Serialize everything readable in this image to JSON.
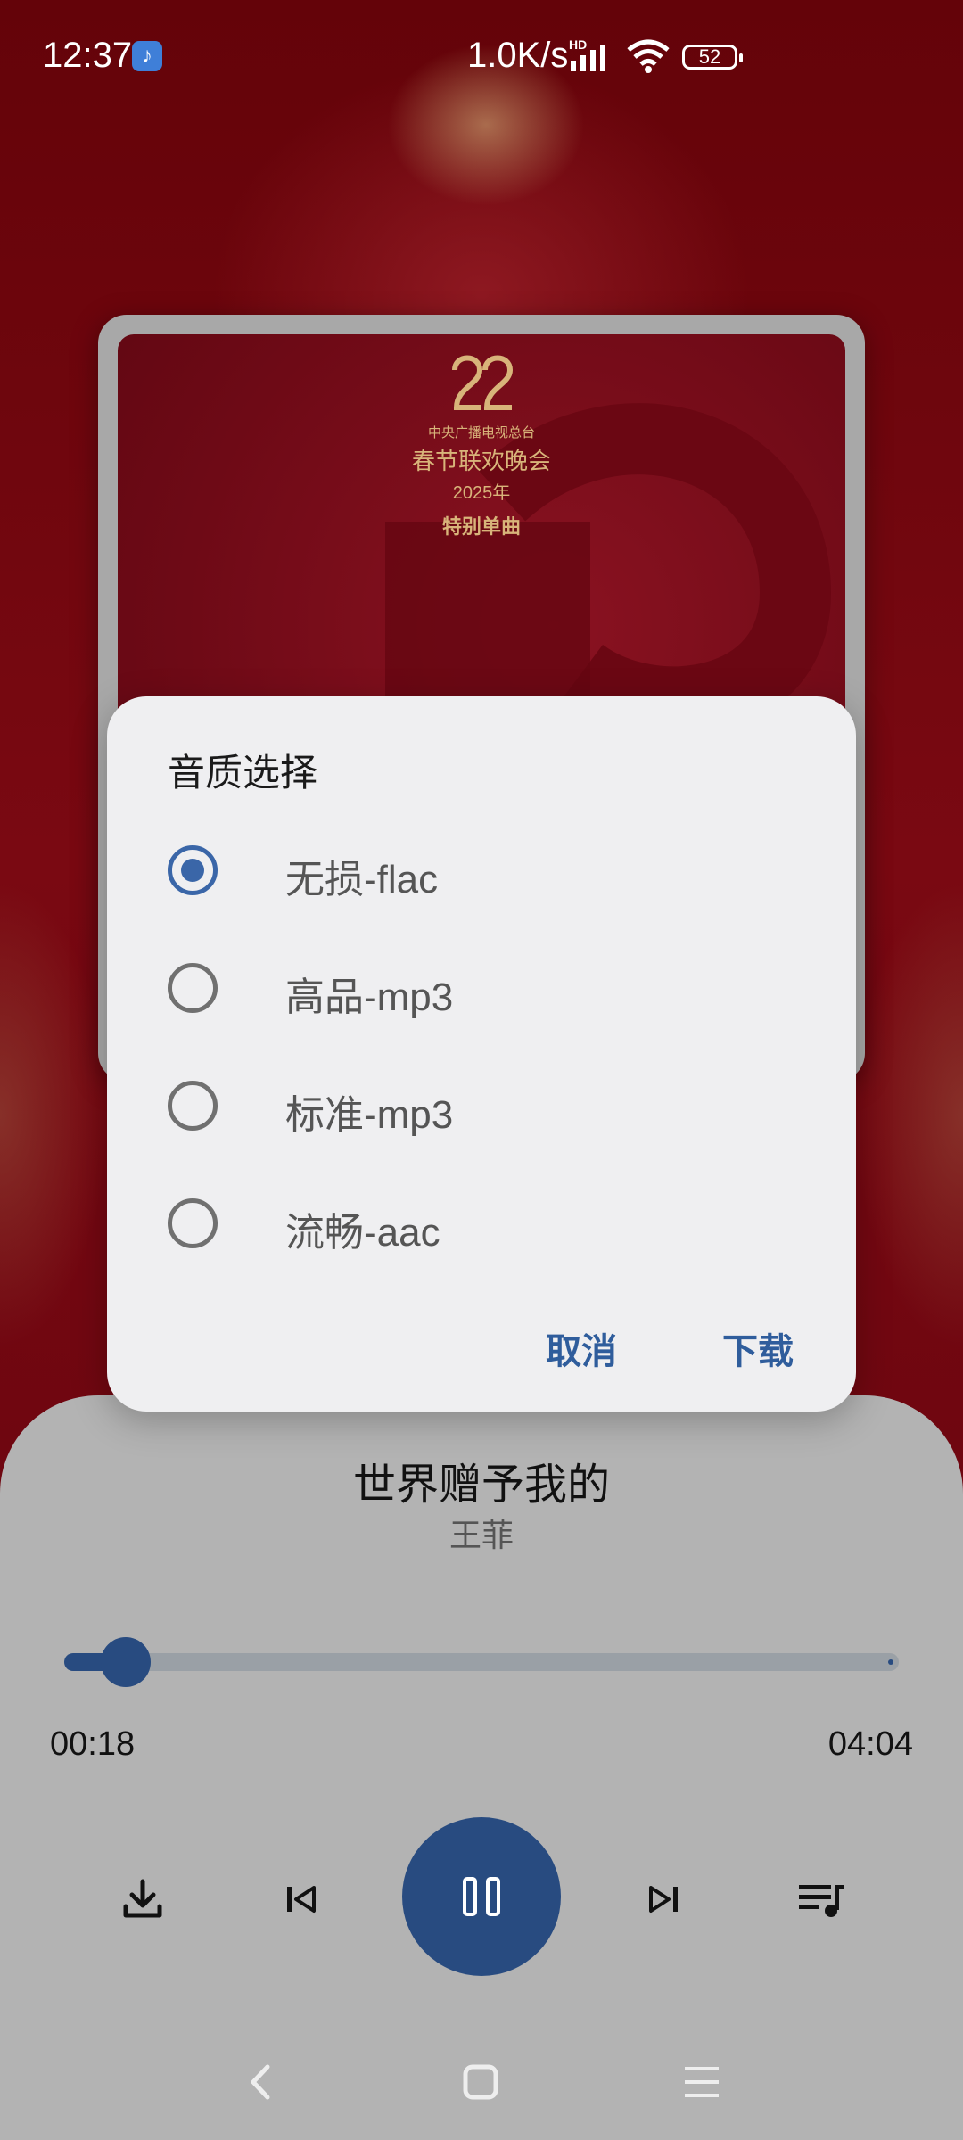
{
  "status_bar": {
    "time": "12:37",
    "app_icon": "music-note-icon",
    "net_speed": "1.0K/s",
    "hd_badge": "HD",
    "battery": "52"
  },
  "album": {
    "logo_subtitle": "中央广播电视总台",
    "logo_title": "春节联欢晚会",
    "logo_year": "2025年",
    "logo_tag": "特别单曲"
  },
  "dialog": {
    "title": "音质选择",
    "options": [
      {
        "label": "无损-flac",
        "selected": true
      },
      {
        "label": "高品-mp3",
        "selected": false
      },
      {
        "label": "标准-mp3",
        "selected": false
      },
      {
        "label": "流畅-aac",
        "selected": false
      }
    ],
    "cancel_label": "取消",
    "confirm_label": "下载"
  },
  "player": {
    "song_title": "世界赠予我的",
    "artist": "王菲",
    "current_time": "00:18",
    "total_time": "04:04",
    "progress_fraction": 0.074,
    "accent_color": "#284b80"
  },
  "icons": {
    "download": "download-icon",
    "previous": "skip-previous-icon",
    "play_pause": "pause-icon",
    "next": "skip-next-icon",
    "playlist": "playlist-icon",
    "nav_back": "back-chevron-icon",
    "nav_home": "home-square-icon",
    "nav_menu": "menu-lines-icon"
  }
}
